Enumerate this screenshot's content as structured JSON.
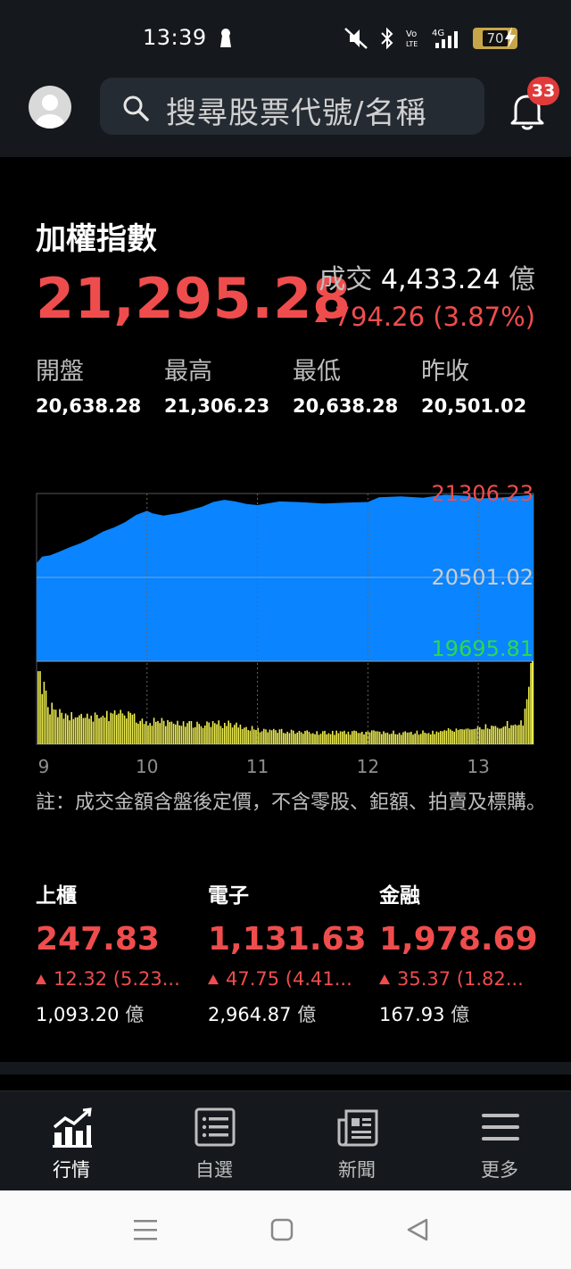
{
  "status_bar": {
    "time": "13:39",
    "battery": "70"
  },
  "search": {
    "placeholder": "搜尋股票代號/名稱"
  },
  "notifications": {
    "count": "33"
  },
  "index": {
    "name": "加權指數",
    "price": "21,295.28",
    "turnover_label": "成交",
    "turnover_value": "4,433.24",
    "turnover_unit": "億",
    "change": "794.26 (3.87%)"
  },
  "stats": [
    {
      "label": "開盤",
      "value": "20,638.28"
    },
    {
      "label": "最高",
      "value": "21,306.23"
    },
    {
      "label": "最低",
      "value": "20,638.28"
    },
    {
      "label": "昨收",
      "value": "20,501.02"
    }
  ],
  "colors": {
    "up": "#ef4d4d",
    "down": "#2bd94c",
    "area": "#0a84ff",
    "volume": "#eded4f"
  },
  "chart_data": {
    "type": "area",
    "y_labels": [
      "21306.23",
      "20501.02",
      "19695.81"
    ],
    "ylim": [
      19695.81,
      21306.23
    ],
    "reference": 20501.02,
    "x_ticks": [
      "9",
      "10",
      "11",
      "12",
      "13"
    ],
    "x_tick_hours": [
      9,
      10,
      11,
      12,
      13
    ],
    "x_range_hours": [
      9,
      13.5
    ],
    "price": [
      [
        9.0,
        20638
      ],
      [
        9.05,
        20700
      ],
      [
        9.12,
        20712
      ],
      [
        9.2,
        20745
      ],
      [
        9.3,
        20790
      ],
      [
        9.4,
        20830
      ],
      [
        9.5,
        20880
      ],
      [
        9.6,
        20940
      ],
      [
        9.7,
        20980
      ],
      [
        9.8,
        21030
      ],
      [
        9.9,
        21100
      ],
      [
        10.0,
        21140
      ],
      [
        10.05,
        21115
      ],
      [
        10.15,
        21095
      ],
      [
        10.3,
        21120
      ],
      [
        10.4,
        21150
      ],
      [
        10.5,
        21180
      ],
      [
        10.6,
        21225
      ],
      [
        10.7,
        21245
      ],
      [
        10.8,
        21230
      ],
      [
        10.9,
        21205
      ],
      [
        11.0,
        21195
      ],
      [
        11.2,
        21230
      ],
      [
        11.4,
        21222
      ],
      [
        11.6,
        21210
      ],
      [
        11.8,
        21218
      ],
      [
        12.0,
        21225
      ],
      [
        12.1,
        21270
      ],
      [
        12.3,
        21278
      ],
      [
        12.5,
        21266
      ],
      [
        12.7,
        21295
      ],
      [
        12.9,
        21282
      ],
      [
        13.0,
        21258
      ],
      [
        13.2,
        21268
      ],
      [
        13.4,
        21285
      ],
      [
        13.5,
        21295
      ]
    ],
    "volume": [
      [
        9.0,
        1.0
      ],
      [
        9.1,
        0.45
      ],
      [
        9.3,
        0.33
      ],
      [
        9.5,
        0.33
      ],
      [
        9.8,
        0.36
      ],
      [
        10.0,
        0.28
      ],
      [
        10.3,
        0.26
      ],
      [
        10.5,
        0.24
      ],
      [
        10.8,
        0.25
      ],
      [
        11.0,
        0.18
      ],
      [
        11.3,
        0.16
      ],
      [
        11.6,
        0.14
      ],
      [
        12.0,
        0.15
      ],
      [
        12.3,
        0.14
      ],
      [
        12.6,
        0.15
      ],
      [
        13.0,
        0.2
      ],
      [
        13.2,
        0.23
      ],
      [
        13.4,
        0.26
      ],
      [
        13.5,
        1.0
      ]
    ]
  },
  "note": "註：成交金額含盤後定價，不含零股、鉅額、拍賣及標購。",
  "sub_indices": [
    {
      "name": "上櫃",
      "price": "247.83",
      "change": "12.32 (5.23...",
      "volume": "1,093.20",
      "unit": "億"
    },
    {
      "name": "電子",
      "price": "1,131.63",
      "change": "47.75 (4.41...",
      "volume": "2,964.87",
      "unit": "億"
    },
    {
      "name": "金融",
      "price": "1,978.69",
      "change": "35.37 (1.82...",
      "volume": "167.93",
      "unit": "億"
    }
  ],
  "nav": [
    {
      "label": "行情",
      "icon": "chart-icon"
    },
    {
      "label": "自選",
      "icon": "list-icon"
    },
    {
      "label": "新聞",
      "icon": "news-icon"
    },
    {
      "label": "更多",
      "icon": "menu-icon"
    }
  ]
}
